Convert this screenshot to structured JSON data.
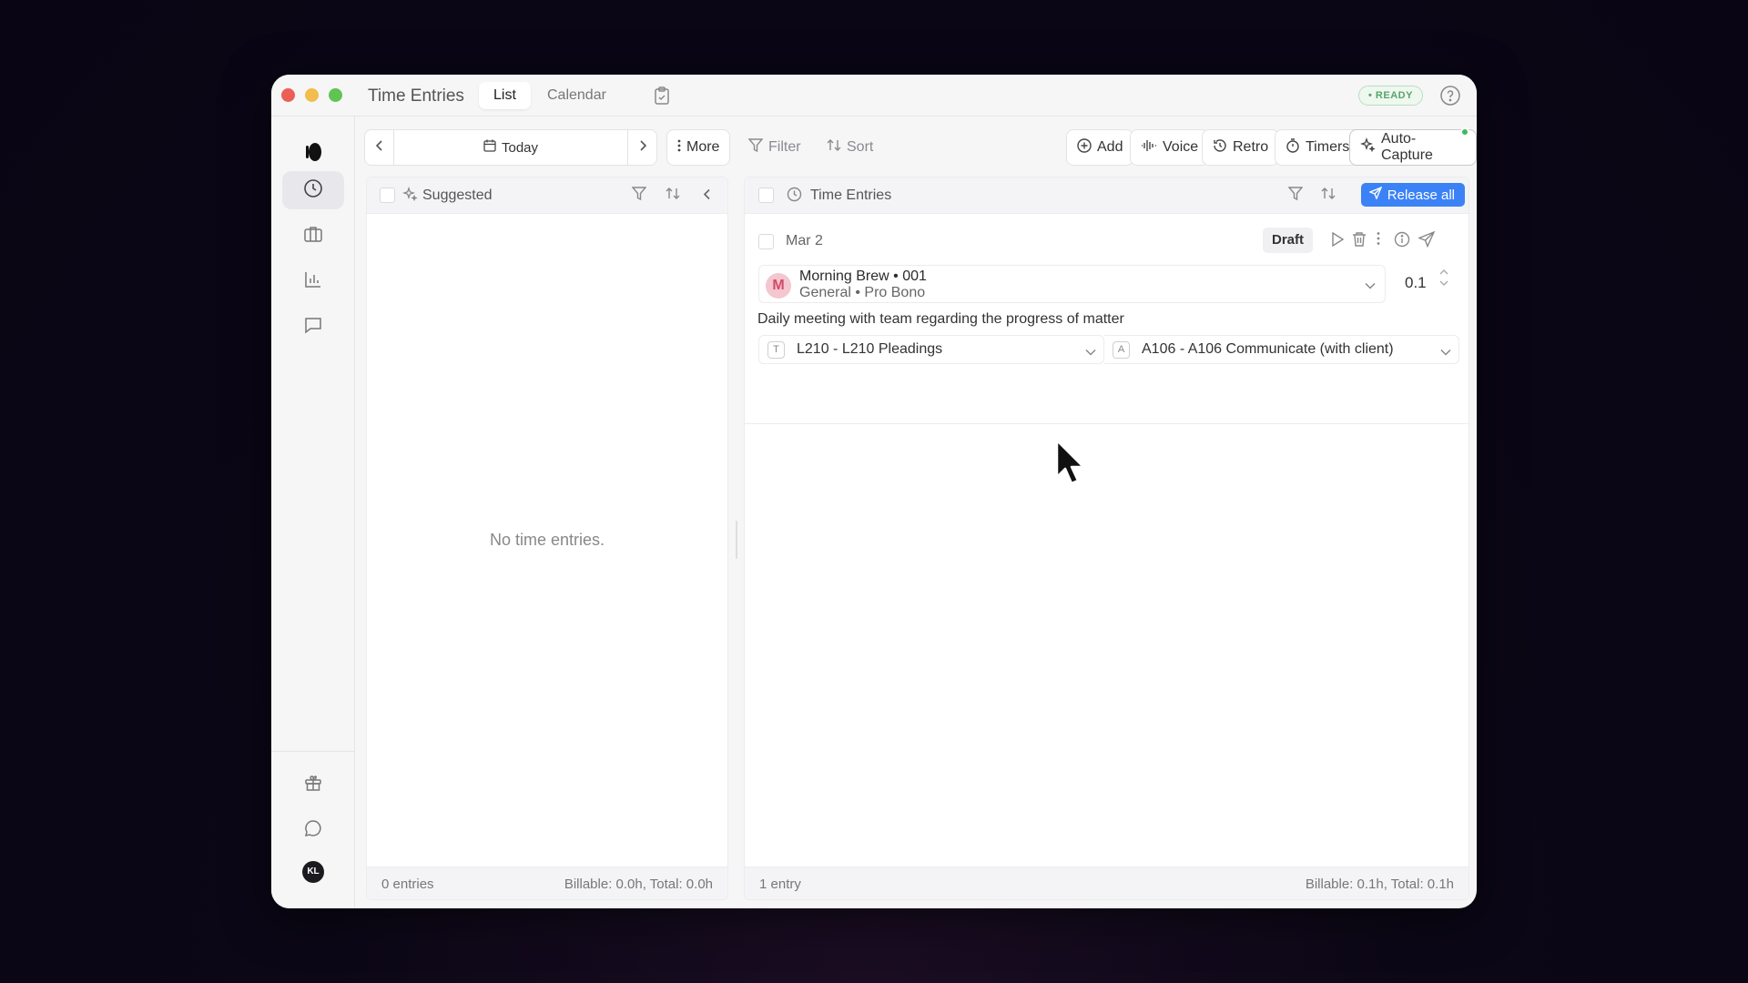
{
  "window": {
    "title": "Time Entries",
    "tabs": [
      {
        "label": "List",
        "active": true
      },
      {
        "label": "Calendar",
        "active": false
      }
    ],
    "status_badge": "• READY"
  },
  "toolbar": {
    "today_label": "Today",
    "more_label": "More",
    "filter_label": "Filter",
    "sort_label": "Sort",
    "add_label": "Add",
    "voice_label": "Voice",
    "retro_label": "Retro",
    "timers_label": "Timers",
    "auto_capture_label": "Auto-Capture"
  },
  "suggested": {
    "title": "Suggested",
    "empty_message": "No time entries.",
    "footer_count": "0 entries",
    "footer_totals": "Billable: 0.0h, Total: 0.0h"
  },
  "entries": {
    "title": "Time Entries",
    "release_label": "Release all",
    "items": [
      {
        "date": "Mar 2",
        "status": "Draft",
        "matter_initial": "M",
        "matter_line1": "Morning Brew • 001",
        "matter_line2": "General • Pro Bono",
        "hours": "0.1",
        "description": "Daily meeting with team regarding the progress of matter",
        "task_letter": "T",
        "task_code": "L210 - L210 Pleadings",
        "activity_letter": "A",
        "activity_code": "A106 - A106 Communicate (with client)"
      }
    ],
    "footer_count": "1 entry",
    "footer_totals": "Billable: 0.1h, Total: 0.1h"
  },
  "user": {
    "initials": "KL"
  },
  "colors": {
    "accent": "#3b82f6",
    "ready": "#58a46a",
    "matter_avatar": "#f4c6cf"
  }
}
